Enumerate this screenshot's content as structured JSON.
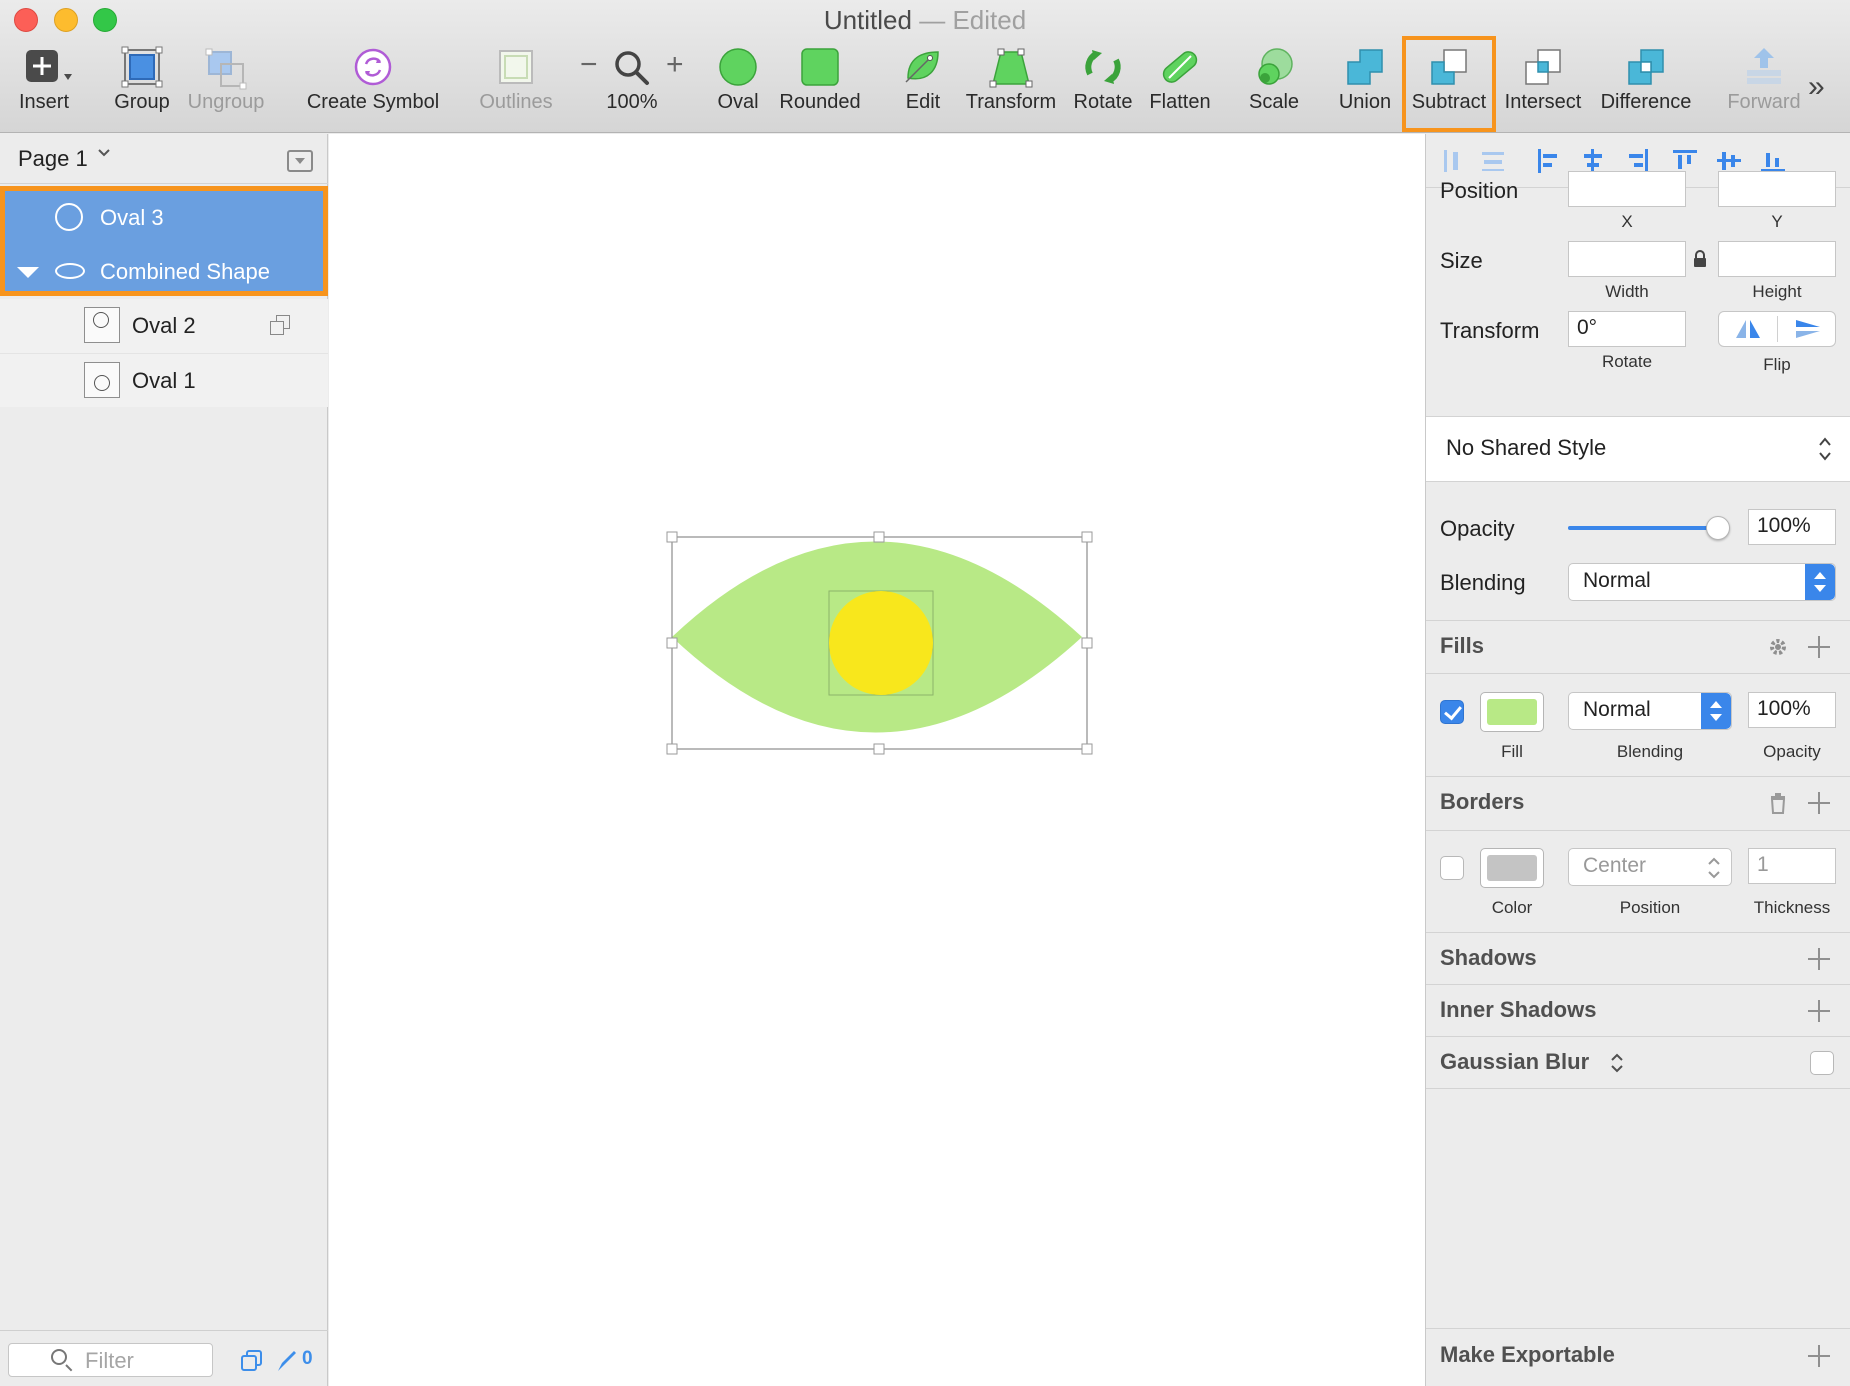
{
  "window": {
    "title": "Untitled",
    "separator": "—",
    "status": "Edited"
  },
  "toolbar": {
    "insert": "Insert",
    "group": "Group",
    "ungroup": "Ungroup",
    "create_symbol": "Create Symbol",
    "outlines": "Outlines",
    "zoom_minus": "−",
    "zoom_plus": "+",
    "zoom": "100%",
    "oval": "Oval",
    "rounded": "Rounded",
    "edit": "Edit",
    "transform": "Transform",
    "rotate": "Rotate",
    "flatten": "Flatten",
    "scale": "Scale",
    "union": "Union",
    "subtract": "Subtract",
    "intersect": "Intersect",
    "difference": "Difference",
    "forward": "Forward",
    "overflow": "»"
  },
  "sidebar": {
    "page": "Page 1",
    "layers": [
      {
        "name": "Oval 3",
        "selected": true,
        "icon": "oval-icon"
      },
      {
        "name": "Combined Shape",
        "selected": true,
        "expanded": true,
        "icon": "combined-shape-icon"
      },
      {
        "name": "Oval 2",
        "selected": false,
        "icon": "oval-thumbnail"
      },
      {
        "name": "Oval 1",
        "selected": false,
        "icon": "oval-thumbnail"
      }
    ],
    "filter_placeholder": "Filter",
    "slice_count": "0"
  },
  "canvas": {
    "outer_fill": "#b8e986",
    "inner_fill": "#f8e71c",
    "selection_color": "#8c8c8c"
  },
  "inspector": {
    "position_label": "Position",
    "x_label": "X",
    "y_label": "Y",
    "x_value": "",
    "y_value": "",
    "size_label": "Size",
    "width_label": "Width",
    "height_label": "Height",
    "width_value": "",
    "height_value": "",
    "transform_label": "Transform",
    "rotate_value": "0°",
    "rotate_label": "Rotate",
    "flip_label": "Flip",
    "shared_style": "No Shared Style",
    "opacity_label": "Opacity",
    "opacity_value": "100%",
    "opacity_level": 1.0,
    "blending_label": "Blending",
    "blending_value": "Normal",
    "fills_title": "Fills",
    "fill_enabled": true,
    "fill_color": "#b8e986",
    "fill_label": "Fill",
    "fill_blending_value": "Normal",
    "fill_blending_label": "Blending",
    "fill_opacity_value": "100%",
    "fill_opacity_label": "Opacity",
    "borders_title": "Borders",
    "border_enabled": false,
    "border_color": "#c4c4c4",
    "border_color_label": "Color",
    "border_position_value": "Center",
    "border_position_label": "Position",
    "border_thickness_value": "1",
    "border_thickness_label": "Thickness",
    "shadows_title": "Shadows",
    "inner_shadows_title": "Inner Shadows",
    "gaussian_blur_title": "Gaussian Blur",
    "gaussian_blur_enabled": false,
    "exportable_title": "Make Exportable",
    "accent": "#3a86ea",
    "highlight": "#f7941d"
  }
}
